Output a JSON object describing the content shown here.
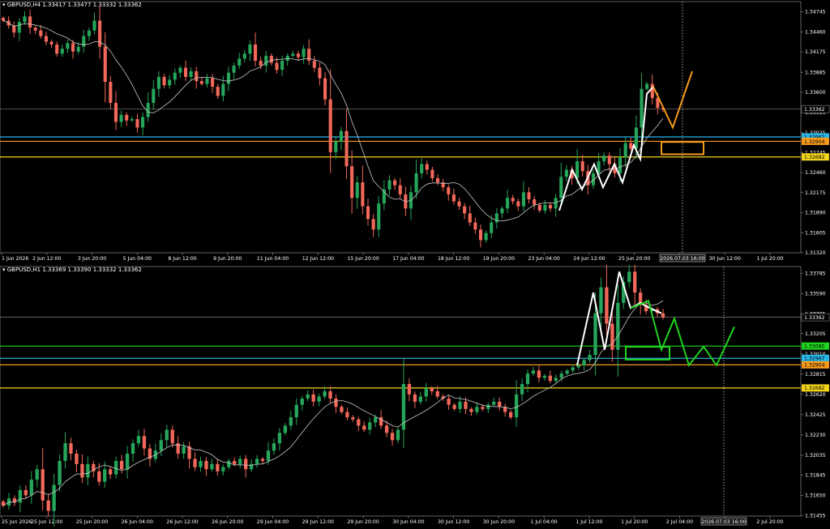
{
  "colors": {
    "bull": "#26a65b",
    "bear": "#f2685a",
    "ma": "#c8c8c8",
    "grid": "#555555",
    "axis": "#888888",
    "current": "#808080",
    "cyan": "#29b6e8",
    "orange": "#f59a1b",
    "yellow": "#f2d41b",
    "green": "#1ed41e",
    "white": "#ffffff"
  },
  "panels": [
    {
      "id": "h4",
      "header": {
        "symbol": "GBPUSD,H4",
        "ohlc": "1.33417 1.33477 1.33332 1.33362"
      },
      "price_range": [
        1.3132,
        1.3489
      ],
      "price_ticks": [
        "1.34745",
        "1.34460",
        "1.34175",
        "1.33885",
        "1.33600",
        "1.33315",
        "1.33025",
        "1.32745",
        "1.32460",
        "1.32175",
        "1.31890",
        "1.31605",
        "1.31320"
      ],
      "time_labels": [
        "1 Jun 2026",
        "2 Jun 12:00",
        "3 Jun 20:00",
        "5 Jun 04:00",
        "8 Jun 12:00",
        "9 Jun 20:00",
        "11 Jun 04:00",
        "12 Jun 12:00",
        "15 Jun 20:00",
        "17 Jun 04:00",
        "18 Jun 12:00",
        "19 Jun 20:00",
        "23 Jun 04:00",
        "24 Jun 12:00",
        "25 Jun 20:00",
        "29 Jun 04:00",
        "30 Jun 12:00",
        "1 Jul 20:00"
      ],
      "cursor_time": "2026.07.03 16:00",
      "hlines": [
        {
          "price": "1.33362",
          "value": 1.33362,
          "color": "current"
        },
        {
          "price": "1.32967",
          "value": 1.32967,
          "color": "cyan"
        },
        {
          "price": "1.32904",
          "value": 1.32904,
          "color": "orange"
        },
        {
          "price": "1.32682",
          "value": 1.32682,
          "color": "yellow"
        }
      ],
      "series": [
        1.3462,
        1.3455,
        1.3445,
        1.346,
        1.3468,
        1.3452,
        1.3448,
        1.344,
        1.3432,
        1.3428,
        1.3415,
        1.3422,
        1.343,
        1.3418,
        1.3425,
        1.344,
        1.3448,
        1.3462,
        1.3425,
        1.3375,
        1.3345,
        1.3318,
        1.3328,
        1.332,
        1.3322,
        1.331,
        1.3325,
        1.3345,
        1.3365,
        1.3382,
        1.337,
        1.3378,
        1.3388,
        1.3395,
        1.3382,
        1.339,
        1.3376,
        1.3372,
        1.338,
        1.3368,
        1.3355,
        1.3372,
        1.3388,
        1.3398,
        1.3408,
        1.3415,
        1.3428,
        1.3405,
        1.3398,
        1.3412,
        1.3402,
        1.3392,
        1.3405,
        1.3412,
        1.3415,
        1.341,
        1.3422,
        1.3405,
        1.3395,
        1.338,
        1.335,
        1.3275,
        1.329,
        1.3305,
        1.3255,
        1.321,
        1.3232,
        1.3198,
        1.318,
        1.3165,
        1.3202,
        1.3222,
        1.3235,
        1.3228,
        1.3215,
        1.3195,
        1.3218,
        1.3245,
        1.3258,
        1.325,
        1.3238,
        1.3232,
        1.3225,
        1.3215,
        1.3205,
        1.3198,
        1.3188,
        1.3175,
        1.3165,
        1.315,
        1.316,
        1.3175,
        1.3188,
        1.3195,
        1.321,
        1.3205,
        1.3198,
        1.3218,
        1.3208,
        1.32,
        1.3192,
        1.32,
        1.3195,
        1.321,
        1.324,
        1.325,
        1.3238,
        1.3262,
        1.3248,
        1.3228,
        1.3245,
        1.3262,
        1.327,
        1.3258,
        1.3245,
        1.3268,
        1.3288,
        1.328,
        1.331,
        1.3365,
        1.3372,
        1.3352,
        1.3338,
        1.3336
      ]
    },
    {
      "id": "h1",
      "header": {
        "symbol": "GBPUSD,H1",
        "ohlc": "1.33369 1.33390 1.33332 1.33362"
      },
      "price_range": [
        1.3145,
        1.3385
      ],
      "price_ticks": [
        "1.33785",
        "1.33590",
        "1.33395",
        "1.33205",
        "1.33010",
        "1.32815",
        "1.32620",
        "1.32425",
        "1.32230",
        "1.32035",
        "1.31845",
        "1.31650",
        "1.31455"
      ],
      "time_labels": [
        "25 Jun 2026",
        "25 Jun 12:00",
        "25 Jun 20:00",
        "26 Jun 04:00",
        "26 Jun 12:00",
        "26 Jun 20:00",
        "29 Jun 04:00",
        "29 Jun 12:00",
        "29 Jun 20:00",
        "30 Jun 04:00",
        "30 Jun 12:00",
        "30 Jun 20:00",
        "1 Jul 04:00",
        "1 Jul 12:00",
        "1 Jul 20:00",
        "2 Jul 04:00",
        "2 Jul 12:00",
        "2 Jul 20:00"
      ],
      "cursor_time": "2026.07.03 16:00",
      "hlines": [
        {
          "price": "1.33362",
          "value": 1.33362,
          "color": "current"
        },
        {
          "price": "1.33085",
          "value": 1.33085,
          "color": "green"
        },
        {
          "price": "1.32967",
          "value": 1.32967,
          "color": "cyan"
        },
        {
          "price": "1.32904",
          "value": 1.32904,
          "color": "orange"
        },
        {
          "price": "1.32682",
          "value": 1.32682,
          "color": "yellow"
        }
      ],
      "series": [
        1.3155,
        1.3162,
        1.3158,
        1.317,
        1.3165,
        1.318,
        1.319,
        1.316,
        1.315,
        1.3175,
        1.3198,
        1.3215,
        1.3205,
        1.3195,
        1.3182,
        1.3195,
        1.3188,
        1.3178,
        1.319,
        1.3185,
        1.3198,
        1.319,
        1.3205,
        1.3215,
        1.3222,
        1.321,
        1.32,
        1.3208,
        1.3218,
        1.3228,
        1.3215,
        1.3205,
        1.3212,
        1.32,
        1.3192,
        1.3198,
        1.319,
        1.3195,
        1.3188,
        1.3192,
        1.3198,
        1.3195,
        1.32,
        1.319,
        1.3195,
        1.32,
        1.3198,
        1.3208,
        1.3215,
        1.3225,
        1.3232,
        1.324,
        1.3252,
        1.3258,
        1.3262,
        1.3255,
        1.326,
        1.3265,
        1.3258,
        1.325,
        1.3245,
        1.324,
        1.3238,
        1.3232,
        1.3228,
        1.3235,
        1.324,
        1.3232,
        1.3225,
        1.3218,
        1.3228,
        1.3272,
        1.3262,
        1.3255,
        1.326,
        1.3268,
        1.3265,
        1.326,
        1.3258,
        1.3252,
        1.3248,
        1.3255,
        1.3248,
        1.3245,
        1.325,
        1.3248,
        1.3252,
        1.3255,
        1.325,
        1.3245,
        1.324,
        1.3262,
        1.3272,
        1.3282,
        1.3285,
        1.3278,
        1.328,
        1.3275,
        1.3278,
        1.3282,
        1.3285,
        1.3288,
        1.329,
        1.3295,
        1.33,
        1.334,
        1.3365,
        1.333,
        1.3305,
        1.335,
        1.337,
        1.338,
        1.336,
        1.3348,
        1.3342,
        1.3344,
        1.334,
        1.3336
      ]
    }
  ]
}
